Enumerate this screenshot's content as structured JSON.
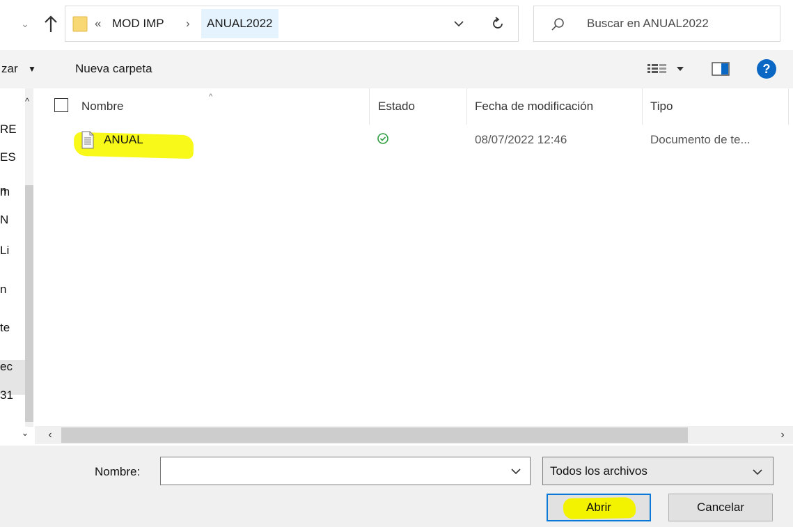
{
  "address": {
    "overflow_chevron": "«",
    "segments": [
      "MOD IMP",
      "ANUAL2022"
    ],
    "separator": "›"
  },
  "search": {
    "placeholder": "Buscar en ANUAL2022"
  },
  "toolbar": {
    "organize_label": "zar",
    "new_folder_label": "Nueva carpeta",
    "help_label": "?"
  },
  "nav_pane": {
    "fragments": [
      "m",
      "RE",
      "ES",
      "n",
      "N",
      "Li",
      "n",
      "te",
      "ec",
      "31"
    ]
  },
  "columns": {
    "name": "Nombre",
    "status": "Estado",
    "modified": "Fecha de modificación",
    "type": "Tipo"
  },
  "files": [
    {
      "name": "ANUAL",
      "status": "synced",
      "modified": "08/07/2022 12:46",
      "type": "Documento de te..."
    }
  ],
  "footer": {
    "name_label": "Nombre:",
    "name_value": "",
    "filter_value": "Todos los archivos",
    "open_label": "Abrir",
    "cancel_label": "Cancelar"
  },
  "colors": {
    "accent": "#0a78d7",
    "highlight": "#f3f300",
    "help_icon": "#0a67c3",
    "status_ok": "#2e9e3f"
  }
}
